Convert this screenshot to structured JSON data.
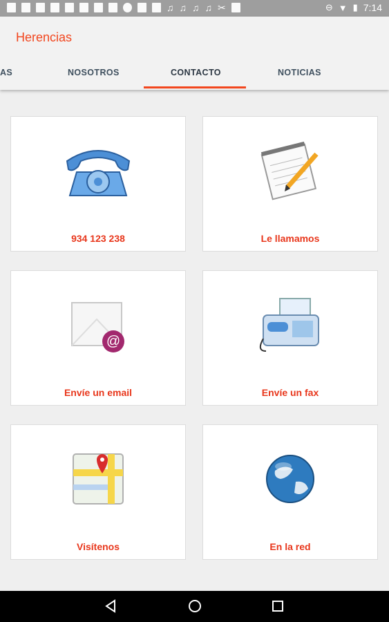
{
  "status_bar": {
    "time": "7:14"
  },
  "app": {
    "title": "Herencias"
  },
  "tabs": [
    {
      "label": "AS"
    },
    {
      "label": "NOSOTROS"
    },
    {
      "label": "CONTACTO"
    },
    {
      "label": "NOTICIAS"
    }
  ],
  "cards": [
    {
      "label": "934 123 238",
      "icon": "telephone-icon"
    },
    {
      "label": "Le llamamos",
      "icon": "notepad-pencil-icon"
    },
    {
      "label": "Envíe un email",
      "icon": "email-envelope-icon"
    },
    {
      "label": "Envíe un fax",
      "icon": "fax-machine-icon"
    },
    {
      "label": "Visítenos",
      "icon": "map-pin-icon"
    },
    {
      "label": "En la red",
      "icon": "globe-icon"
    }
  ],
  "colors": {
    "accent": "#f2461e",
    "appbar": "#f2f2f2",
    "background": "#efefef"
  }
}
